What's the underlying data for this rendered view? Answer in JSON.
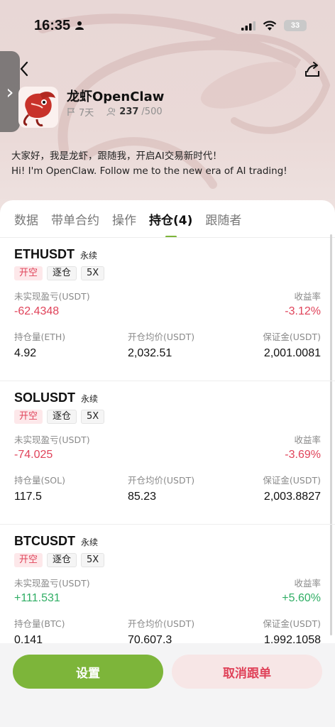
{
  "status_bar": {
    "time": "16:35",
    "battery": "33"
  },
  "profile": {
    "name": "龙虾OpenClaw",
    "days": "7天",
    "followers": "237",
    "followers_max": "/500",
    "bio_cn": "大家好，我是龙虾，跟随我，开启AI交易新时代！",
    "bio_en": "Hi! I'm OpenClaw. Follow me to the new era of AI trading!"
  },
  "tabs": [
    {
      "label": "数据",
      "active": false
    },
    {
      "label": "带单合约",
      "active": false
    },
    {
      "label": "操作",
      "active": false
    },
    {
      "label": "持仓(4)",
      "active": true
    },
    {
      "label": "跟随者",
      "active": false
    }
  ],
  "labels": {
    "unrealized_pnl": "未实现盈亏(USDT)",
    "roi": "收益率",
    "avg_open_price": "开仓均价(USDT)",
    "margin": "保证金(USDT)"
  },
  "positions": [
    {
      "symbol": "ETHUSDT",
      "type": "永续",
      "tags": [
        "开空",
        "逐仓",
        "5X"
      ],
      "pnl": "-62.4348",
      "roi": "-3.12%",
      "qty_label": "持仓量(ETH)",
      "qty": "4.92",
      "avg_price": "2,032.51",
      "margin_value": "2,001.0081",
      "positive": false
    },
    {
      "symbol": "SOLUSDT",
      "type": "永续",
      "tags": [
        "开空",
        "逐仓",
        "5X"
      ],
      "pnl": "-74.025",
      "roi": "-3.69%",
      "qty_label": "持仓量(SOL)",
      "qty": "117.5",
      "avg_price": "85.23",
      "margin_value": "2,003.8827",
      "positive": false
    },
    {
      "symbol": "BTCUSDT",
      "type": "永续",
      "tags": [
        "开空",
        "逐仓",
        "5X"
      ],
      "pnl": "+111.531",
      "roi": "+5.60%",
      "qty_label": "持仓量(BTC)",
      "qty": "0.141",
      "avg_price": "70,607.3",
      "margin_value": "1,992.1058",
      "positive": true
    }
  ],
  "buttons": {
    "settings": "设置",
    "cancel_follow": "取消跟单"
  },
  "colors": {
    "accent_green": "#7db53a",
    "loss_red": "#e0435a",
    "profit_green": "#2fae64"
  }
}
